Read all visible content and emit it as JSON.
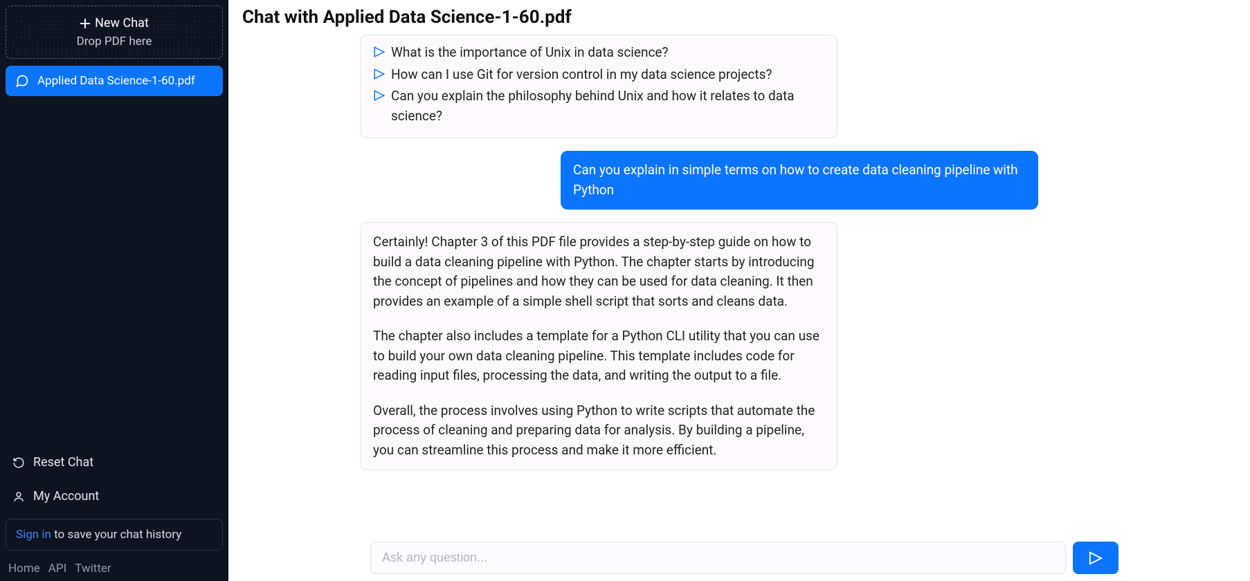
{
  "sidebar": {
    "new_chat_label": "New Chat",
    "drop_pdf_label": "Drop PDF here",
    "active_chat": "Applied Data Science-1-60.pdf",
    "reset_chat": "Reset Chat",
    "my_account": "My Account",
    "sign_in": "Sign in",
    "sign_in_suffix": " to save your chat history",
    "footer": {
      "home": "Home",
      "api": "API",
      "twitter": "Twitter"
    }
  },
  "header": {
    "title": "Chat with Applied Data Science-1-60.pdf"
  },
  "messages": {
    "suggested_questions": [
      "What is the importance of Unix in data science?",
      "How can I use Git for version control in my data science projects?",
      "Can you explain the philosophy behind Unix and how it relates to data science?"
    ],
    "user_question": "Can you explain in simple terms on how to create data cleaning pipeline with Python",
    "answer_paragraphs": [
      "Certainly! Chapter 3 of this PDF file provides a step-by-step guide on how to build a data cleaning pipeline with Python. The chapter starts by introducing the concept of pipelines and how they can be used for data cleaning. It then provides an example of a simple shell script that sorts and cleans data.",
      "The chapter also includes a template for a Python CLI utility that you can use to build your own data cleaning pipeline. This template includes code for reading input files, processing the data, and writing the output to a file.",
      "Overall, the process involves using Python to write scripts that automate the process of cleaning and preparing data for analysis. By building a pipeline, you can streamline this process and make it more efficient."
    ]
  },
  "input": {
    "placeholder": "Ask any question..."
  }
}
